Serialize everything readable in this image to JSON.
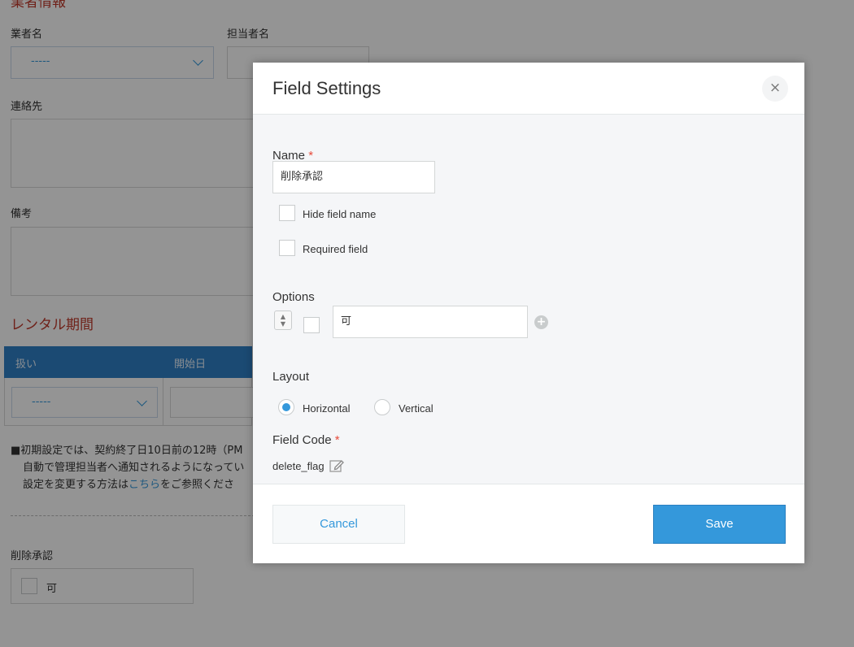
{
  "background": {
    "section_title_top": "業者情報",
    "vendor_label": "業者名",
    "vendor_select_value": "-----",
    "contact_person_label": "担当者名",
    "contact_label": "連絡先",
    "remarks_label": "備考",
    "rental_section_title": "レンタル期間",
    "table_columns": [
      "扱い",
      "開始日"
    ],
    "table_select_value": "-----",
    "notes": [
      "■初期設定では、契約終了日10日前の12時（PM",
      "自動で管理担当者へ通知されるようになってい",
      "設定を変更する方法は"
    ],
    "note_link": "こちら",
    "note_suffix": "をご参照くださ",
    "delete_approval_label": "削除承認",
    "delete_approval_option": "可"
  },
  "dialog": {
    "title": "Field Settings",
    "close_glyph": "×",
    "name_label": "Name",
    "required_mark": "*",
    "name_value": "削除承認",
    "hide_field_name_label": "Hide field name",
    "required_field_label": "Required field",
    "options_label": "Options",
    "option_value": "可",
    "layout_label": "Layout",
    "layout_options": [
      "Horizontal",
      "Vertical"
    ],
    "layout_selected": "Horizontal",
    "field_code_label": "Field Code",
    "field_code_value": "delete_flag",
    "cancel_label": "Cancel",
    "save_label": "Save"
  },
  "colors": {
    "accent": "#3498db",
    "required": "#e74c3c",
    "section_title": "#c0392b",
    "table_header": "#2f80c7"
  }
}
